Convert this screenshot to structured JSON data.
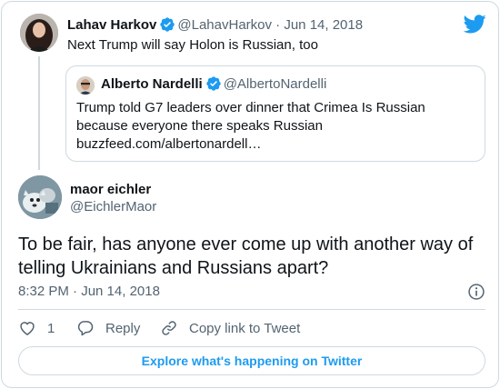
{
  "parent_tweet": {
    "name": "Lahav Harkov",
    "handle": "@LahavHarkov",
    "separator": " · ",
    "date": "Jun 14, 2018",
    "text": "Next Trump will say Holon is Russian, too",
    "verified": true
  },
  "quoted_tweet": {
    "name": "Alberto Nardelli",
    "handle": "@AlbertoNardelli",
    "text": "Trump told G7 leaders over dinner that Crimea Is Russian because everyone there speaks Russian",
    "link": "buzzfeed.com/albertonardell…",
    "verified": true
  },
  "main_tweet": {
    "name": "maor eichler",
    "handle": "@EichlerMaor",
    "text": "To be fair, has anyone ever come up with another way of telling Ukrainians and Russians apart?",
    "timestamp": "8:32 PM · Jun 14, 2018"
  },
  "actions": {
    "like_count": "1",
    "reply_label": "Reply",
    "copy_label": "Copy link to Tweet"
  },
  "explore_label": "Explore what's happening on Twitter",
  "icons": [
    "twitter-bird-icon",
    "verified-badge-icon",
    "info-icon",
    "heart-icon",
    "reply-icon",
    "link-icon"
  ],
  "colors": {
    "brand": "#1d9bf0",
    "text": "#0f1419",
    "muted": "#536471",
    "border": "#cfd9de"
  }
}
